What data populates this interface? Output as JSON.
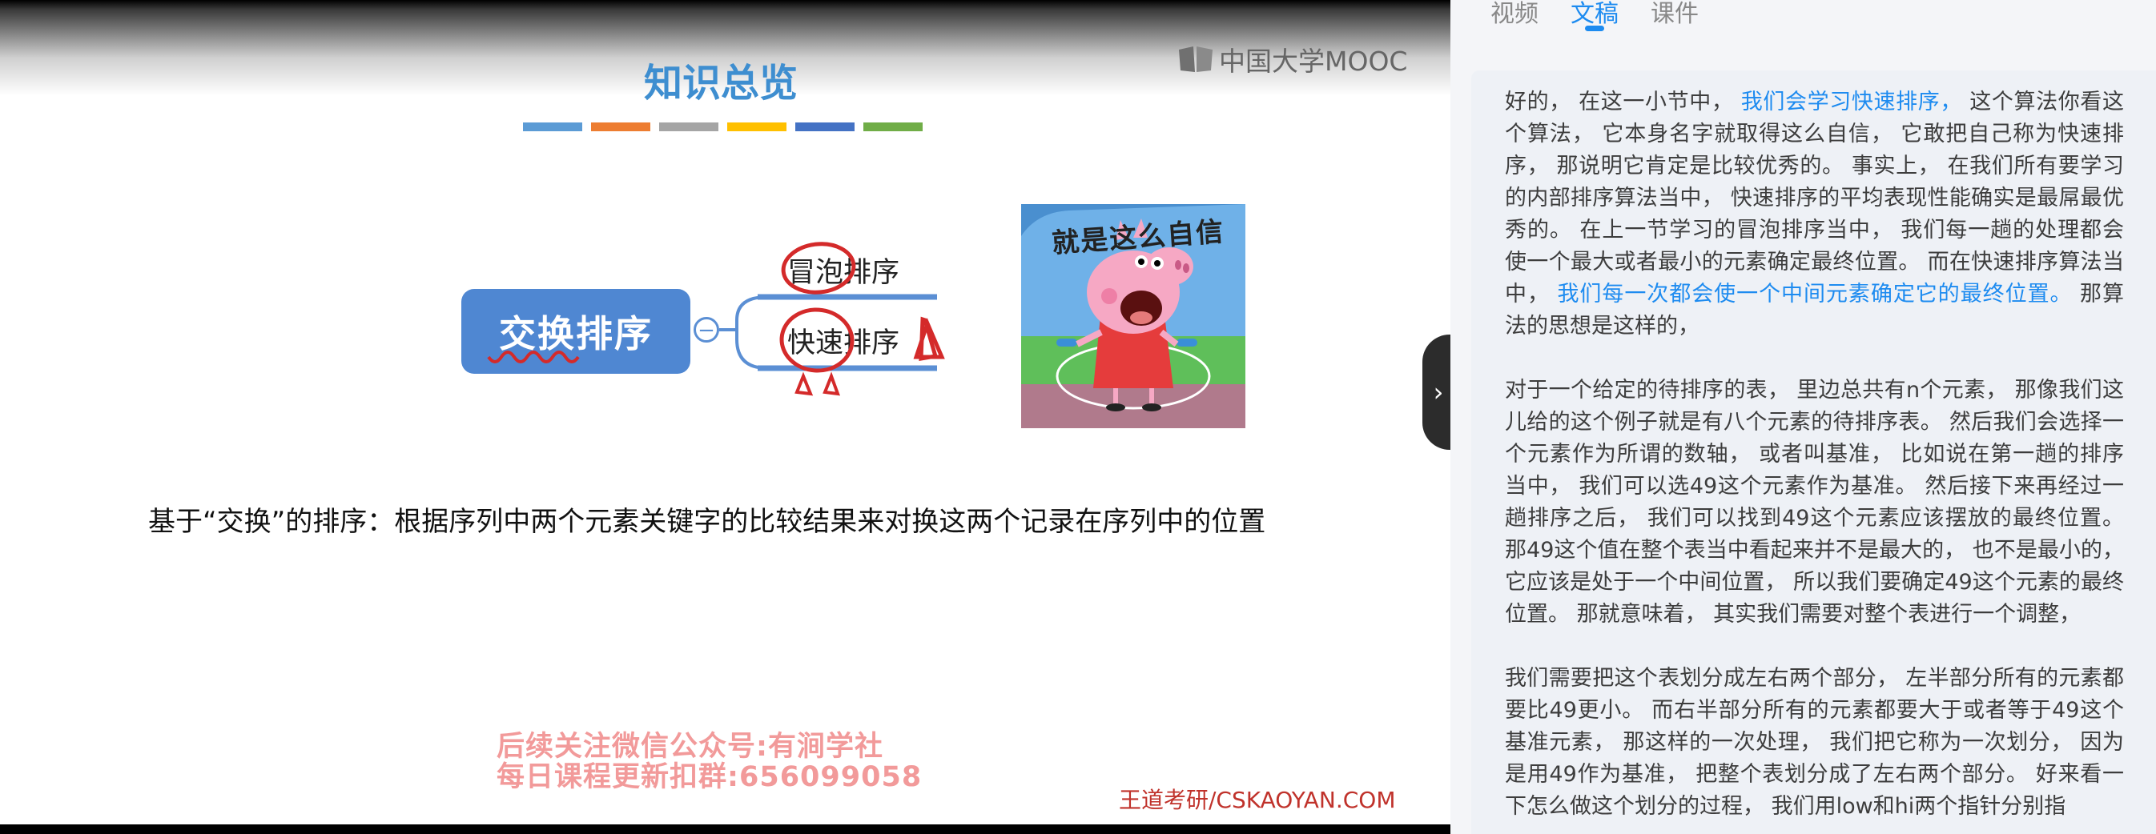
{
  "video": {
    "logo_text": "中国大学MOOC",
    "slide_title": "知识总览",
    "title_strip_colors": [
      "#5b9bd5",
      "#ed7d31",
      "#a5a5a5",
      "#ffc000",
      "#4472c4",
      "#70ad47"
    ],
    "mindmap": {
      "root": "交换排序",
      "collapse_symbol": "−",
      "children": [
        "冒泡排序",
        "快速排序"
      ]
    },
    "meme_caption": "就是这么自信",
    "description": "基于“交换”的排序：根据序列中两个元素关键字的比较结果来对换这两个记录在序列中的位置",
    "watermark_line1": "后续关注微信公众号:有涧学社",
    "watermark_line2": "每日课程更新扣群:656099058",
    "watermark_corner": "王道考研/CSKAOYAN.COM",
    "side_handle_icon": "chevron-right-icon"
  },
  "panel": {
    "tabs": [
      {
        "label": "视频",
        "active": false
      },
      {
        "label": "文稿",
        "active": true
      },
      {
        "label": "课件",
        "active": false
      }
    ],
    "transcript": [
      [
        {
          "text": "好的， 在这一小节中， ",
          "highlight": false
        },
        {
          "text": "我们会学习快速排序，",
          "highlight": true
        },
        {
          "text": " 这个算法你看这个算法， 它本身名字就取得这么自信， 它敢把自己称为快速排序， 那说明它肯定是比较优秀的。 事实上， 在我们所有要学习的内部排序算法当中， 快速排序的平均表现性能确实是最屌最优秀的。 在上一节学习的冒泡排序当中， 我们每一趟的处理都会使一个最大或者最小的元素确定最终位置。 而在快速排序算法当中， ",
          "highlight": false
        },
        {
          "text": "我们每一次都会使一个中间元素确定它的最终位置。",
          "highlight": true
        },
        {
          "text": " 那算法的思想是这样的，",
          "highlight": false
        }
      ],
      [
        {
          "text": "对于一个给定的待排序的表， 里边总共有n个元素， 那像我们这儿给的这个例子就是有八个元素的待排序表。 然后我们会选择一个元素作为所谓的数轴， 或者叫基准， 比如说在第一趟的排序当中， 我们可以选49这个元素作为基准。 然后接下来再经过一趟排序之后， 我们可以找到49这个元素应该摆放的最终位置。 那49这个值在整个表当中看起来并不是最大的， 也不是最小的， 它应该是处于一个中间位置， 所以我们要确定49这个元素的最终位置。 那就意味着， 其实我们需要对整个表进行一个调整，",
          "highlight": false
        }
      ],
      [
        {
          "text": "我们需要把这个表划分成左右两个部分， 左半部分所有的元素都要比49更小。 而右半部分所有的元素都要大于或者等于49这个基准元素， 那这样的一次处理， 我们把它称为一次划分， 因为是用49作为基准， 把整个表划分成了左右两个部分。 好来看一下怎么做这个划分的过程， 我们用low和hi两个指针分别指",
          "highlight": false
        }
      ]
    ]
  }
}
